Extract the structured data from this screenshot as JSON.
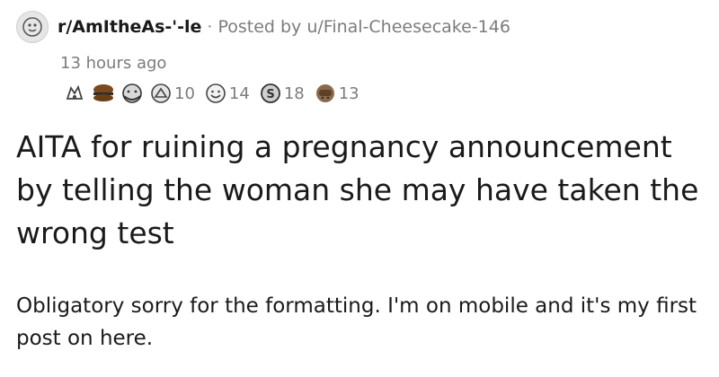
{
  "post": {
    "subreddit": "r/AmItheAs-'-le",
    "separator": "·",
    "posted_by": "Posted by u/Final-Cheesecake-146",
    "time_ago": "13 hours ago",
    "awards": [
      {
        "icon": "wholesome-seal-icon",
        "count": ""
      },
      {
        "icon": "burger-award-icon",
        "count": ""
      },
      {
        "icon": "hugz-award-icon",
        "count": ""
      },
      {
        "icon": "helpful-award-icon",
        "count": "10"
      },
      {
        "icon": "wholesome-award-icon",
        "count": "14"
      },
      {
        "icon": "silver-award-icon",
        "count": "18"
      },
      {
        "icon": "facepalm-award-icon",
        "count": "13"
      }
    ],
    "title": "AITA for ruining a pregnancy announcement by telling the woman she may have taken the wrong test",
    "body": "Obligatory sorry for the formatting. I'm on mobile and it's my first post on here."
  },
  "colors": {
    "text": "#1a1a1b",
    "meta": "#7c7c7c"
  }
}
